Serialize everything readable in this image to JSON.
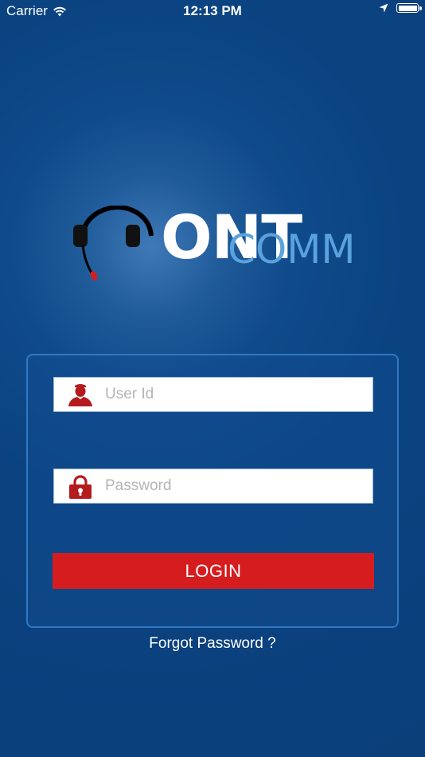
{
  "status_bar": {
    "carrier": "Carrier",
    "time": "12:13 PM",
    "icons": [
      "wifi-icon",
      "location-arrow-icon",
      "battery-icon"
    ]
  },
  "logo": {
    "brand_main": "ONT",
    "brand_sub": "COMM",
    "icon": "headset-icon"
  },
  "login": {
    "user_placeholder": "User Id",
    "password_placeholder": "Password",
    "login_label": "LOGIN",
    "forgot_label": "Forgot Password ?",
    "user_icon": "user-icon",
    "lock_icon": "lock-icon"
  },
  "colors": {
    "background": "#0b4381",
    "accent_red": "#d51d1f",
    "brand_blue": "#5aa2dd",
    "panel_border": "#2f78c4"
  }
}
